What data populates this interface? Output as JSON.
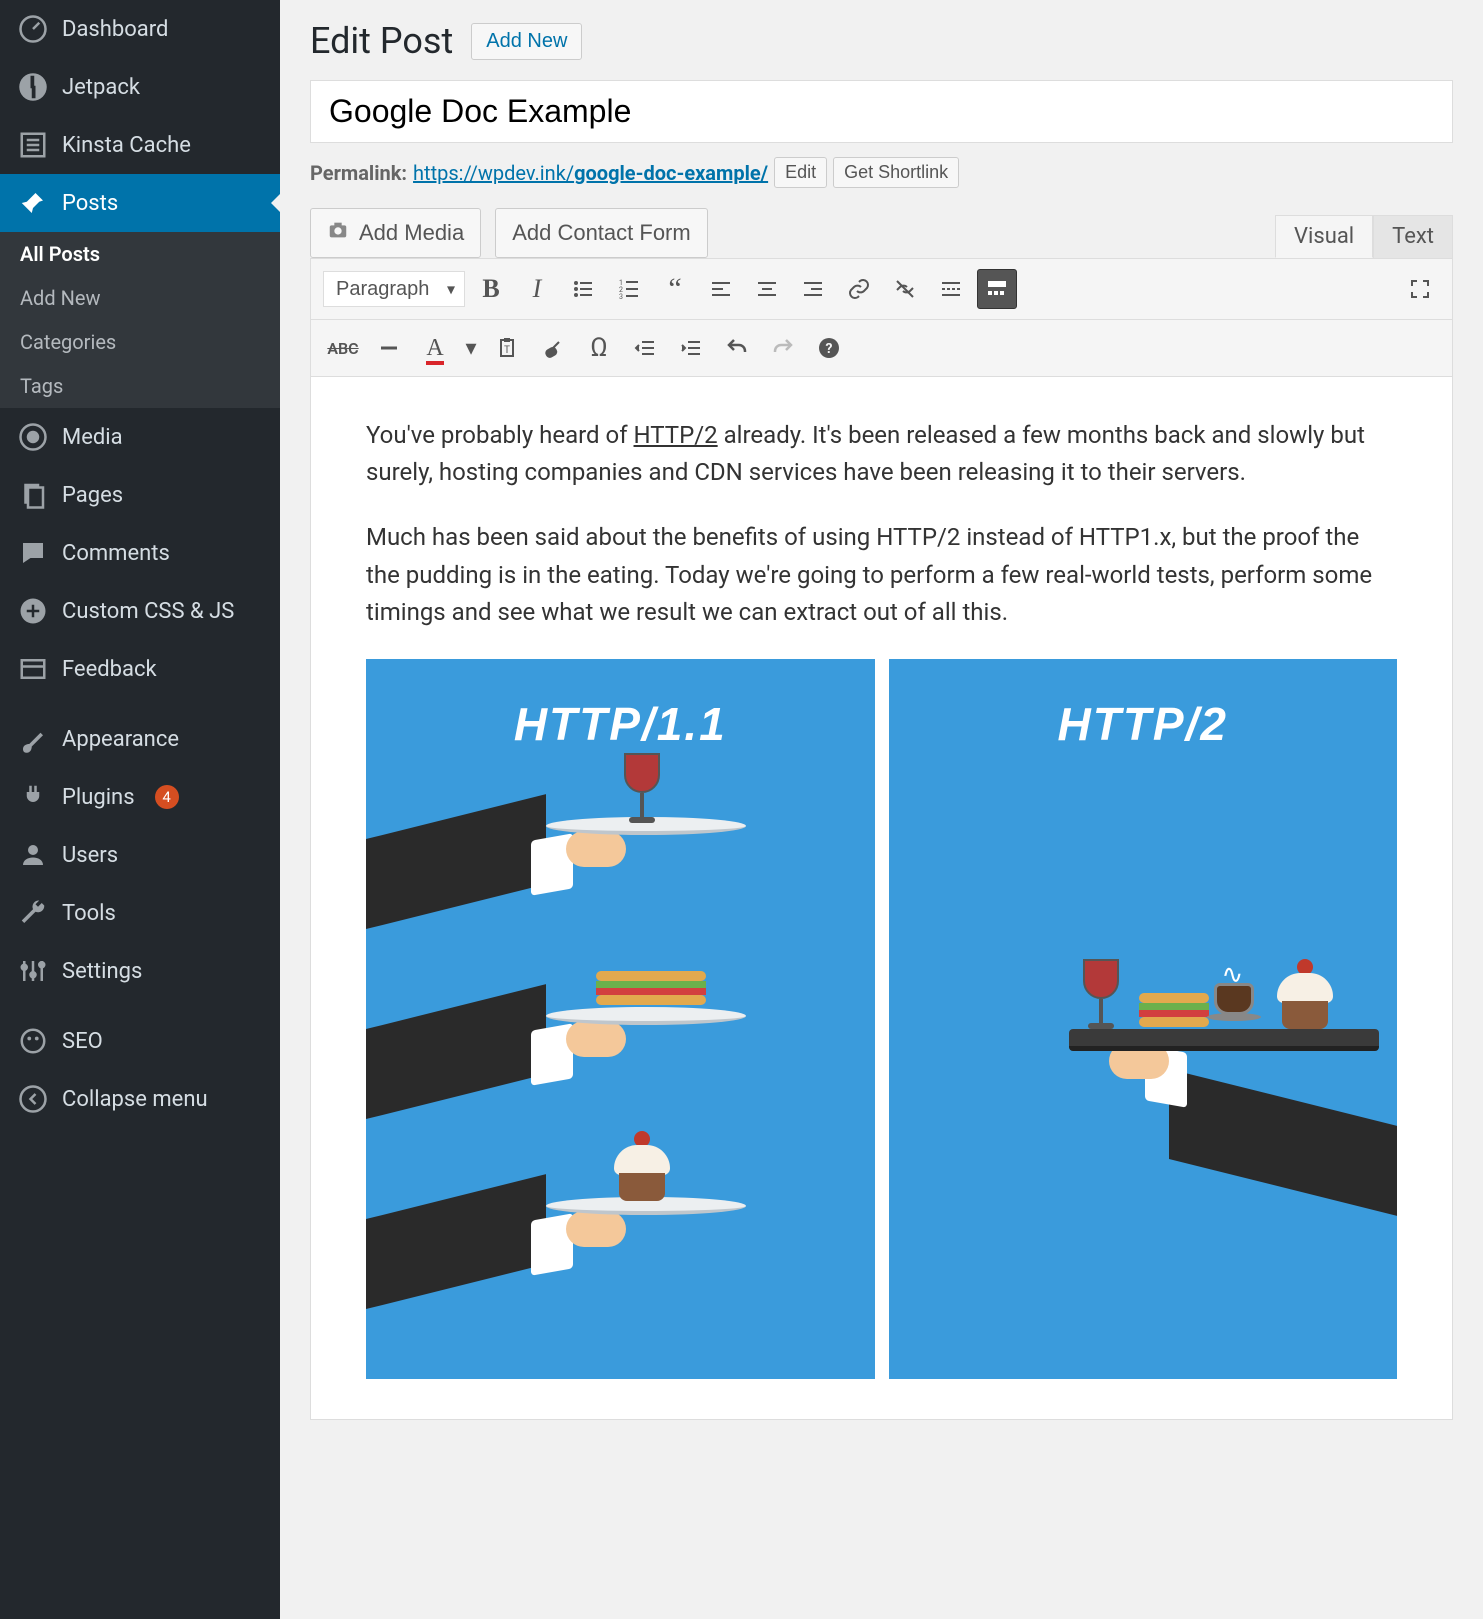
{
  "sidebar": {
    "items": [
      {
        "label": "Dashboard",
        "icon": "dashboard"
      },
      {
        "label": "Jetpack",
        "icon": "jetpack"
      },
      {
        "label": "Kinsta Cache",
        "icon": "cache"
      },
      {
        "label": "Posts",
        "icon": "pin",
        "active": true
      },
      {
        "label": "Media",
        "icon": "media"
      },
      {
        "label": "Pages",
        "icon": "pages"
      },
      {
        "label": "Comments",
        "icon": "comments"
      },
      {
        "label": "Custom CSS & JS",
        "icon": "plus"
      },
      {
        "label": "Feedback",
        "icon": "feedback"
      },
      {
        "label": "Appearance",
        "icon": "brush"
      },
      {
        "label": "Plugins",
        "icon": "plug",
        "badge": "4"
      },
      {
        "label": "Users",
        "icon": "user"
      },
      {
        "label": "Tools",
        "icon": "wrench"
      },
      {
        "label": "Settings",
        "icon": "sliders"
      },
      {
        "label": "SEO",
        "icon": "seo"
      },
      {
        "label": "Collapse menu",
        "icon": "collapse"
      }
    ],
    "submenu": [
      {
        "label": "All Posts",
        "current": true
      },
      {
        "label": "Add New"
      },
      {
        "label": "Categories"
      },
      {
        "label": "Tags"
      }
    ]
  },
  "page": {
    "heading": "Edit Post",
    "add_new": "Add New",
    "title_value": "Google Doc Example",
    "permalink_label": "Permalink:",
    "permalink_base": "https://wpdev.ink/",
    "permalink_slug": "google-doc-example/",
    "edit_btn": "Edit",
    "shortlink_btn": "Get Shortlink",
    "add_media": "Add Media",
    "add_contact": "Add Contact Form",
    "tab_visual": "Visual",
    "tab_text": "Text",
    "format_select": "Paragraph"
  },
  "content": {
    "p1_a": "You've probably heard of ",
    "p1_link": "HTTP/2",
    "p1_b": " already. It's been released a few months back and slowly but surely, hosting companies and CDN services have been releasing it to their servers.",
    "p2": "Much has been said about the benefits of using HTTP/2 instead of HTTP1.x, but the proof the the pudding is in the eating. Today we're going to perform a few real-world tests, perform some timings and see what we result we can extract out of all this.",
    "img_left_title": "HTTP/1.1",
    "img_right_title": "HTTP/2"
  }
}
